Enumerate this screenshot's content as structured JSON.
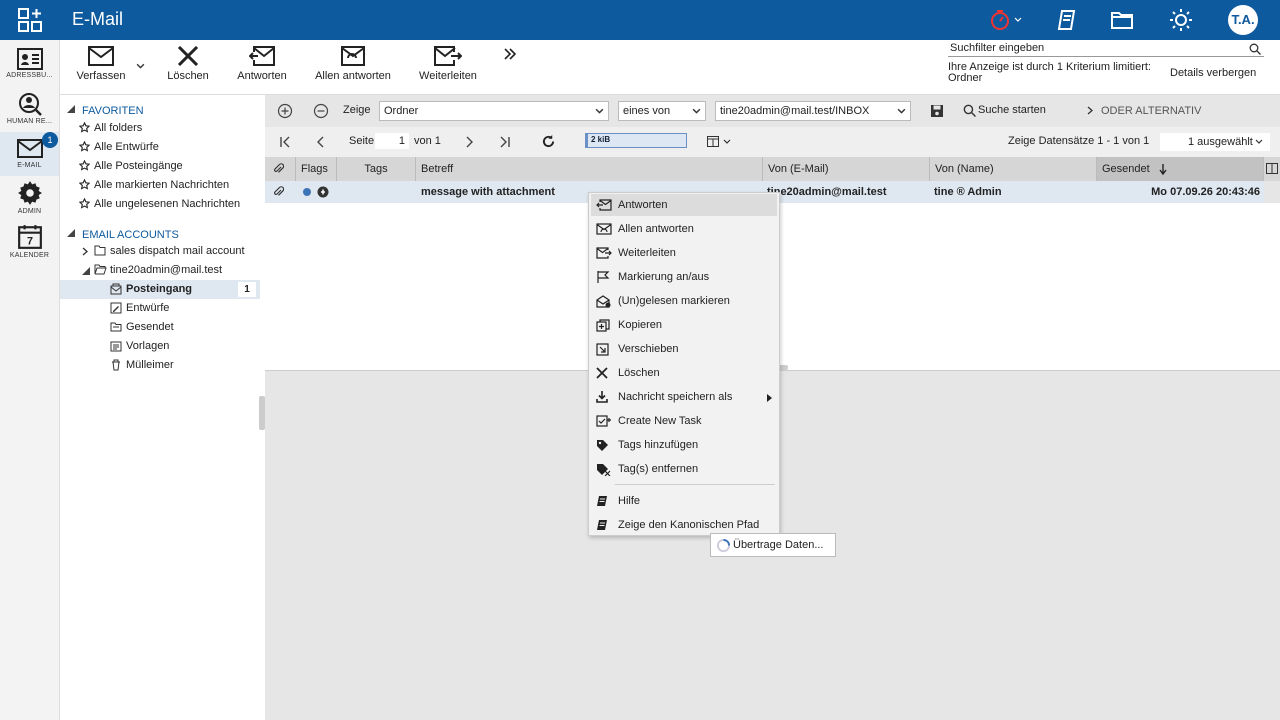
{
  "app": {
    "title": "E-Mail",
    "user_initials": "T.A."
  },
  "rail": [
    {
      "label": "ADRESSBU...",
      "icon": "addressbook-icon"
    },
    {
      "label": "HUMAN RE...",
      "icon": "person-search-icon"
    },
    {
      "label": "E-MAIL",
      "icon": "envelope-icon",
      "badge": "1"
    },
    {
      "label": "ADMIN",
      "icon": "gear-icon"
    },
    {
      "label": "KALENDER",
      "icon": "calendar-icon",
      "day": "7"
    }
  ],
  "toolbar": {
    "compose": "Verfassen",
    "delete": "Löschen",
    "reply": "Antworten",
    "reply_all": "Allen antworten",
    "forward": "Weiterleiten",
    "search_placeholder": "Suchfilter eingeben",
    "filter_info": "Ihre Anzeige ist durch 1 Kriterium limitiert: Ordner",
    "details_label": "Details verbergen"
  },
  "tree": {
    "favorites_header": "FAVORITEN",
    "favorites": [
      "All folders",
      "Alle Entwürfe",
      "Alle Posteingänge",
      "Alle markierten Nachrichten",
      "Alle ungelesenen Nachrichten"
    ],
    "accounts_header": "EMAIL ACCOUNTS",
    "accounts": [
      "sales dispatch mail account",
      "tine20admin@mail.test"
    ],
    "folders": [
      {
        "label": "Posteingang",
        "count": "1"
      },
      {
        "label": "Entwürfe"
      },
      {
        "label": "Gesendet"
      },
      {
        "label": "Vorlagen"
      },
      {
        "label": "Mülleimer"
      }
    ]
  },
  "filter": {
    "show_label": "Zeige",
    "field": "Ordner",
    "operator": "eines von",
    "value": "tine20admin@mail.test/INBOX",
    "search_button": "Suche starten",
    "or_alternative": "ODER ALTERNATIV"
  },
  "paging": {
    "page_label": "Seite",
    "page": "1",
    "of_label": "von 1",
    "quota": "2 kiB",
    "quota_fraction": 0.02,
    "records": "Zeige Datensätze 1 - 1 von 1",
    "selected": "1 ausgewählt"
  },
  "grid": {
    "columns": [
      "Flags",
      "Tags",
      "Betreff",
      "Von (E-Mail)",
      "Von (Name)",
      "Gesendet"
    ],
    "rows": [
      {
        "subject": "message with attachment",
        "from_email": "tine20admin@mail.test",
        "from_name": "tine ® Admin",
        "sent": "Mo 07.09.26 20:43:46"
      }
    ]
  },
  "context_menu": [
    {
      "label": "Antworten",
      "icon": "reply-icon"
    },
    {
      "label": "Allen antworten",
      "icon": "reply-all-icon"
    },
    {
      "label": "Weiterleiten",
      "icon": "forward-icon"
    },
    {
      "label": "Markierung an/aus",
      "icon": "flag-icon"
    },
    {
      "label": "(Un)gelesen markieren",
      "icon": "read-unread-icon"
    },
    {
      "label": "Kopieren",
      "icon": "copy-icon"
    },
    {
      "label": "Verschieben",
      "icon": "move-icon"
    },
    {
      "label": "Löschen",
      "icon": "close-icon"
    },
    {
      "label": "Nachricht speichern als",
      "icon": "download-icon"
    },
    {
      "label": "Create New Task",
      "icon": "task-icon"
    },
    {
      "label": "Tags hinzufügen",
      "icon": "tag-icon"
    },
    {
      "label": "Tag(s) entfernen",
      "icon": "tag-remove-icon"
    },
    {
      "label": "Hilfe",
      "icon": "book-icon"
    },
    {
      "label": "Zeige den Kanonischen Pfad",
      "icon": "book-icon"
    }
  ],
  "loading_text": "Übertrage Daten..."
}
